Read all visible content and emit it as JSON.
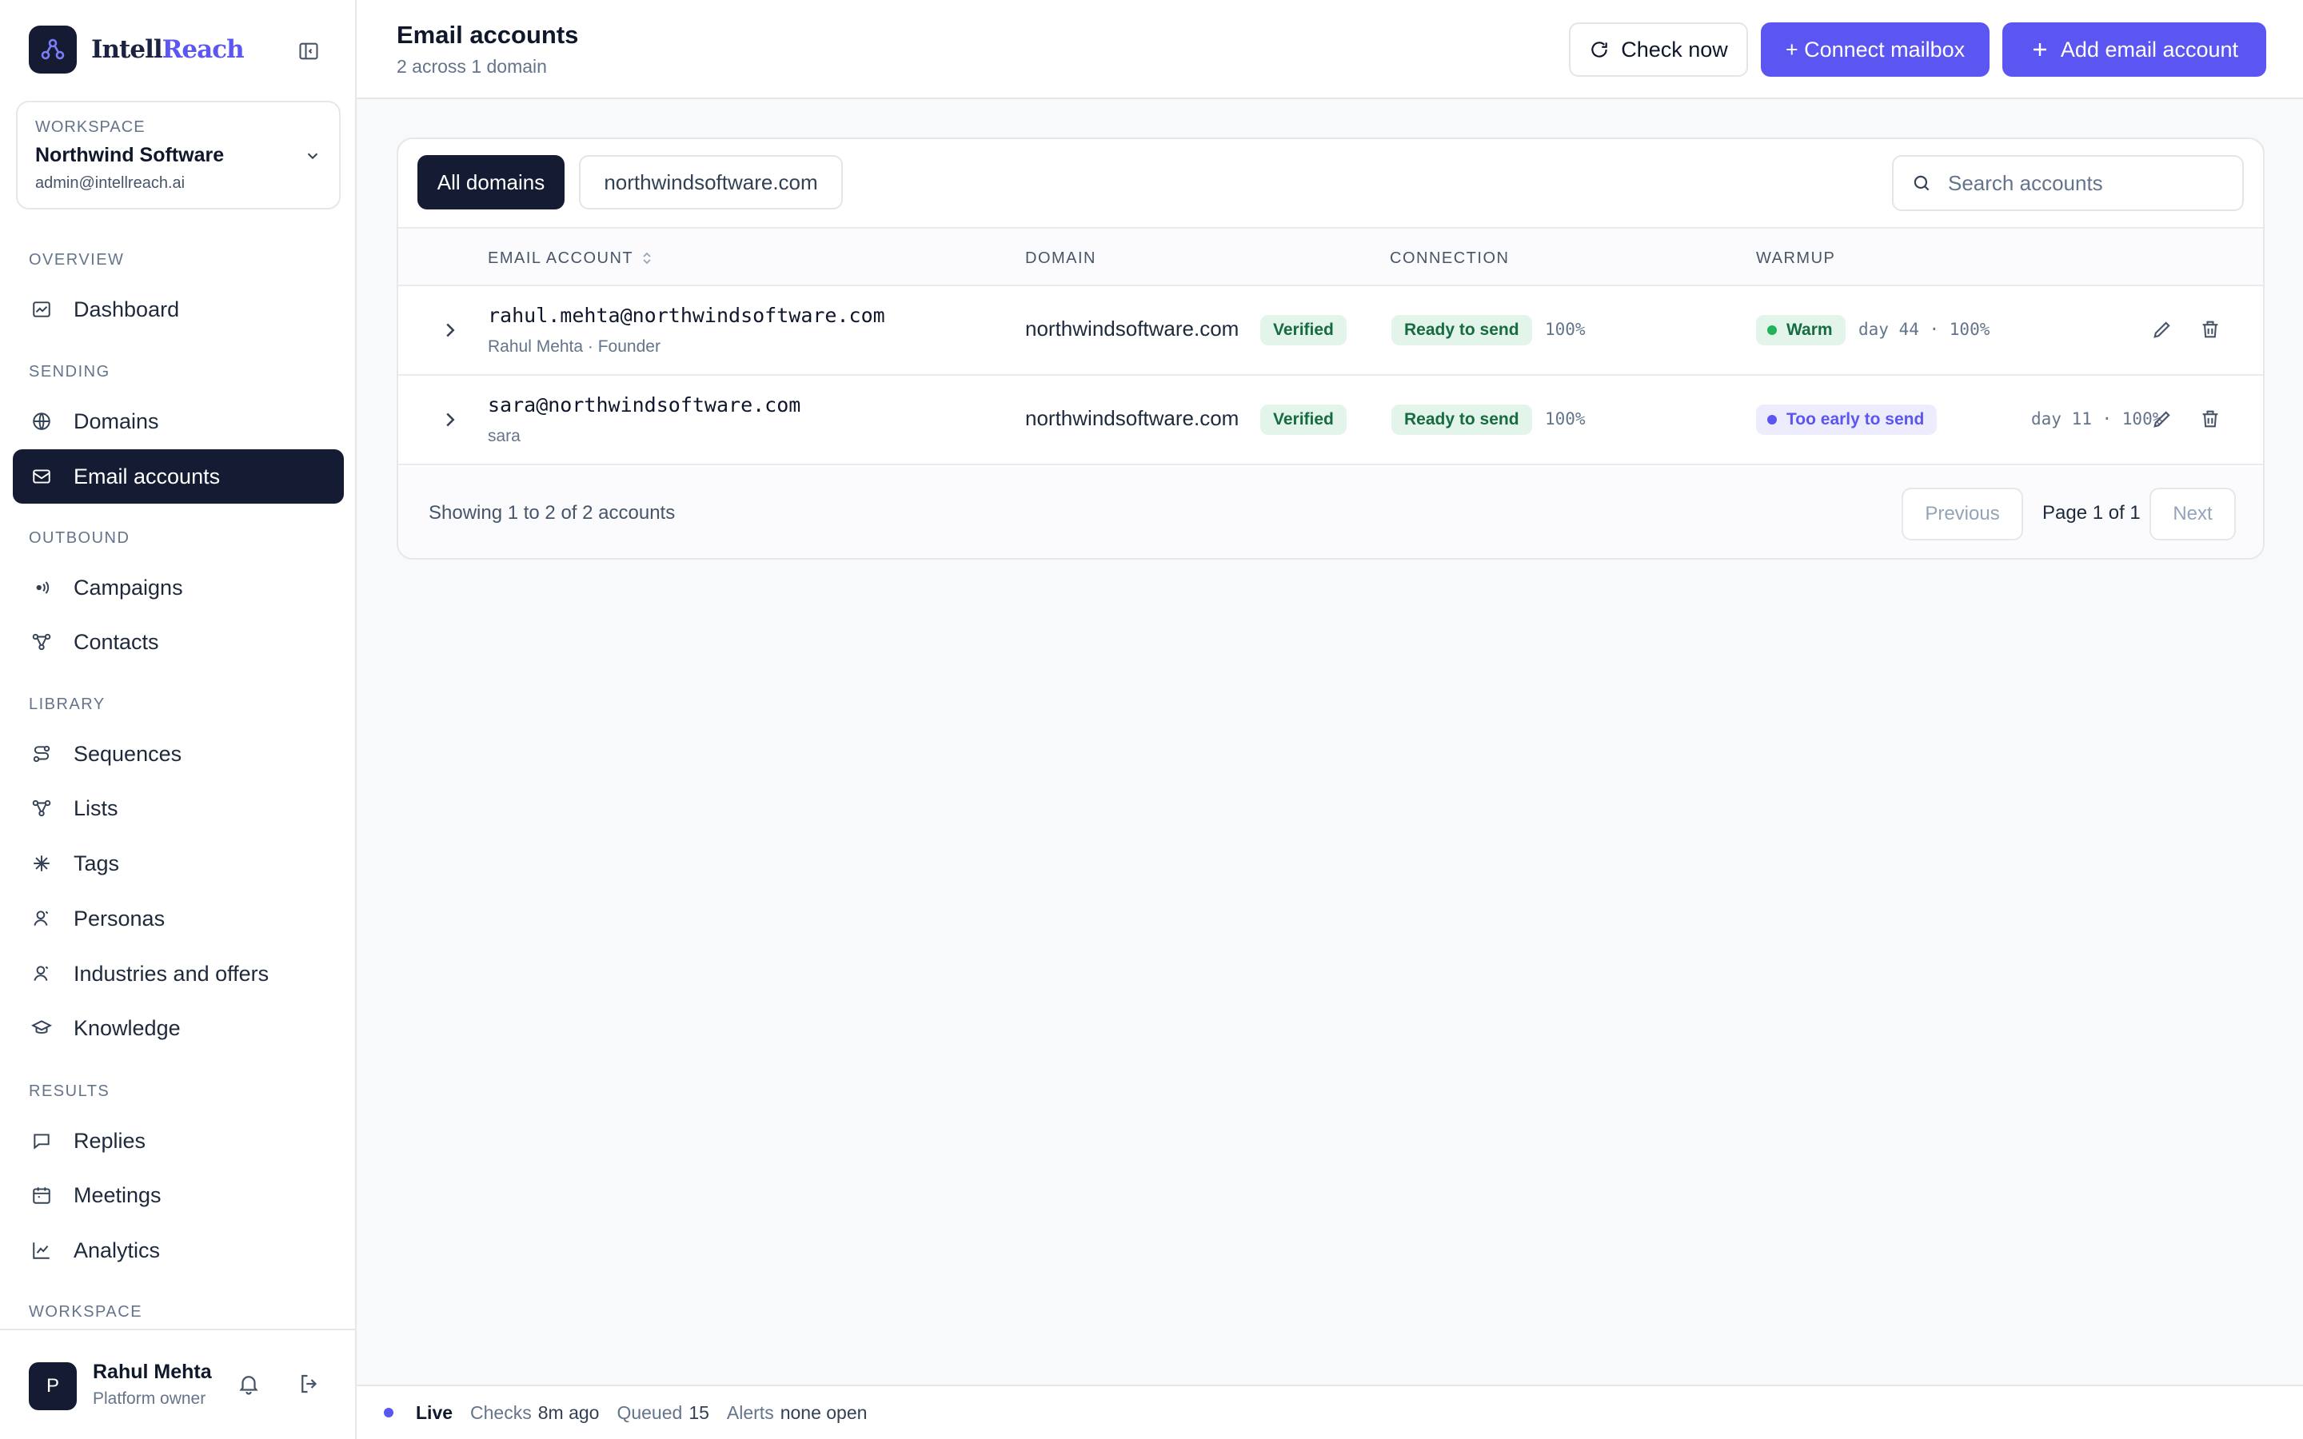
{
  "brand": {
    "name_part1": "Intell",
    "name_part2": "Reach"
  },
  "workspace": {
    "label": "WORKSPACE",
    "name": "Northwind Software",
    "email": "admin@intellreach.ai"
  },
  "nav": {
    "overview": {
      "title": "OVERVIEW",
      "items": [
        {
          "label": "Dashboard",
          "icon": "dashboard-icon"
        }
      ]
    },
    "sending": {
      "title": "SENDING",
      "items": [
        {
          "label": "Domains",
          "icon": "globe-icon"
        },
        {
          "label": "Email accounts",
          "icon": "mail-icon",
          "active": true
        }
      ]
    },
    "outbound": {
      "title": "OUTBOUND",
      "items": [
        {
          "label": "Campaigns",
          "icon": "broadcast-icon"
        },
        {
          "label": "Contacts",
          "icon": "network-icon"
        }
      ]
    },
    "library": {
      "title": "LIBRARY",
      "items": [
        {
          "label": "Sequences",
          "icon": "route-icon"
        },
        {
          "label": "Lists",
          "icon": "network-icon"
        },
        {
          "label": "Tags",
          "icon": "asterisk-icon"
        },
        {
          "label": "Personas",
          "icon": "user-icon"
        },
        {
          "label": "Industries and offers",
          "icon": "user-icon"
        },
        {
          "label": "Knowledge",
          "icon": "book-icon"
        }
      ]
    },
    "results": {
      "title": "RESULTS",
      "items": [
        {
          "label": "Replies",
          "icon": "message-icon"
        },
        {
          "label": "Meetings",
          "icon": "calendar-icon"
        },
        {
          "label": "Analytics",
          "icon": "chart-icon"
        }
      ]
    },
    "workspace": {
      "title": "WORKSPACE"
    }
  },
  "user": {
    "initial": "P",
    "name": "Rahul Mehta",
    "role": "Platform owner"
  },
  "header": {
    "title": "Email accounts",
    "subtitle": "2 across 1 domain",
    "check_now": "Check now",
    "connect_mailbox": "+ Connect mailbox",
    "add_account": "Add email account"
  },
  "filters": {
    "all": "All domains",
    "domain": "northwindsoftware.com",
    "search_placeholder": "Search accounts"
  },
  "table": {
    "columns": {
      "account": "EMAIL ACCOUNT",
      "domain": "DOMAIN",
      "connection": "CONNECTION",
      "warmup": "WARMUP"
    },
    "rows": [
      {
        "email": "rahul.mehta@northwindsoftware.com",
        "name": "Rahul Mehta · Founder",
        "domain": "northwindsoftware.com",
        "domain_status": "Verified",
        "connection": "Ready to send",
        "connection_pct": "100%",
        "warmup_status": "Warm",
        "warmup_detail": "day 44 · 100%"
      },
      {
        "email": "sara@northwindsoftware.com",
        "name": "sara",
        "domain": "northwindsoftware.com",
        "domain_status": "Verified",
        "connection": "Ready to send",
        "connection_pct": "100%",
        "warmup_status": "Too early to send",
        "warmup_detail": "day 11 · 100%"
      }
    ]
  },
  "footer": {
    "showing": "Showing 1 to 2 of 2 accounts",
    "previous": "Previous",
    "page": "Page 1 of 1",
    "next": "Next"
  },
  "status": {
    "live": "Live",
    "checks_label": "Checks",
    "checks_value": "8m ago",
    "queued_label": "Queued",
    "queued_value": "15",
    "alerts_label": "Alerts",
    "alerts_value": "none open"
  },
  "colors": {
    "primary": "#5b55f2",
    "nav_active": "#141b33",
    "success": "#176b40"
  }
}
